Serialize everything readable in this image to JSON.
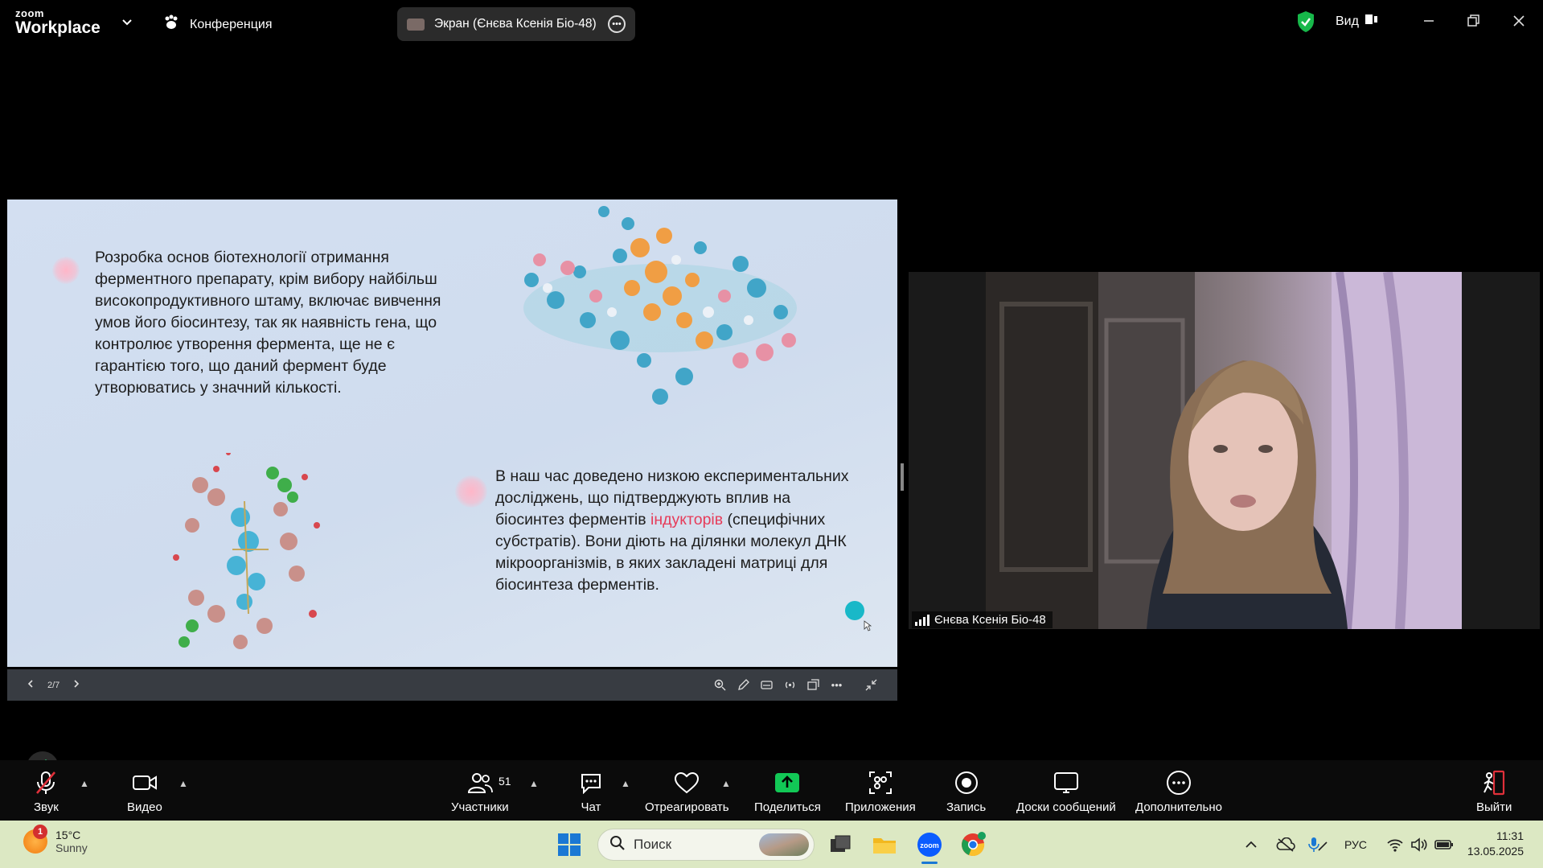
{
  "app": {
    "logo_top": "zoom",
    "logo_bottom": "Workplace"
  },
  "header": {
    "meeting_label": "Конференция",
    "share_label": "Экран (Єнєва Ксенія Біо-48)",
    "view_label": "Вид"
  },
  "slide": {
    "text1": "Розробка основ біотехнології отримання ферментного препарату, крім вибору найбільш високопродуктивного штаму, включає вивчення умов його біосинтезу, так як наявність гена, що контролює утворення фермента, ще не є гарантією того, що даний фермент буде утворюватись у значний кількості.",
    "text2_part1": "В наш час доведено низкою експериментальних досліджень, що підтверджують вплив на біосинтез ферментів ",
    "text2_highlight": "індукторів",
    "text2_part2": " (специфічних субстратів). Вони діють на ділянки молекул ДНК мікроорганізмів, в яких закладені матриці для біосинтеза ферментів.",
    "highlight_color": "#e63c5a",
    "page_indicator": "2/7",
    "progress": 0.2857
  },
  "video": {
    "participant_name": "Єнєва Ксенія Біо-48"
  },
  "toolbar": {
    "audio": "Звук",
    "video": "Видео",
    "participants": "Участники",
    "participants_count": "51",
    "chat": "Чат",
    "react": "Отреагировать",
    "share": "Поделиться",
    "apps": "Приложения",
    "record": "Запись",
    "whiteboards": "Доски сообщений",
    "more": "Дополнительно",
    "leave": "Выйти",
    "share_color": "#12c856",
    "leave_color": "#e0303a"
  },
  "taskbar": {
    "temperature": "15°C",
    "weather": "Sunny",
    "weather_badge": "1",
    "search_placeholder": "Поиск",
    "language": "РУС",
    "time": "11:31",
    "date": "13.05.2025"
  }
}
